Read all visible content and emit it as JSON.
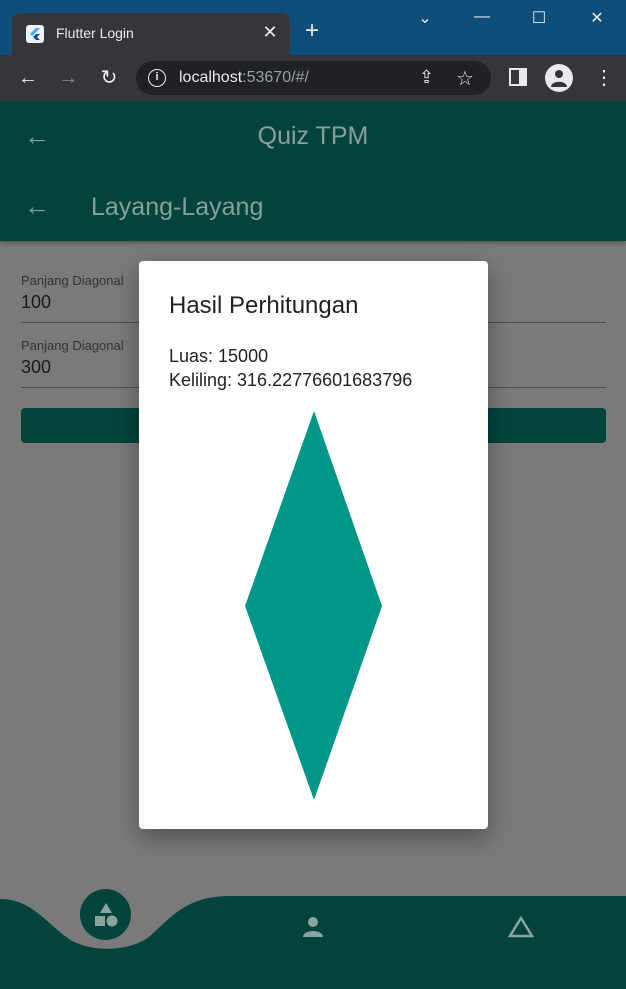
{
  "browser": {
    "tab_title": "Flutter Login",
    "tab_close": "✕",
    "new_tab": "+",
    "url_host": "localhost",
    "url_path": ":53670/#/",
    "info_icon": "i",
    "window_controls": {
      "dropdown": "⌄",
      "minimize": "—",
      "maximize": "☐",
      "close": "✕"
    }
  },
  "app": {
    "appbar_title": "Quiz TPM",
    "subpage_title": "Layang-Layang",
    "fields": [
      {
        "label": "Panjang Diagonal",
        "value": "100"
      },
      {
        "label": "Panjang Diagonal",
        "value": "300"
      }
    ],
    "bottom_nav": [
      "shapes-icon",
      "person-icon",
      "triangle-icon"
    ],
    "colors": {
      "primary": "#02443c",
      "accent": "#009688"
    }
  },
  "dialog": {
    "title": "Hasil Perhitungan",
    "luas_text": "Luas: 15000",
    "keliling_text": "Keliling: 316.22776601683796",
    "kite_color": "#009688"
  }
}
